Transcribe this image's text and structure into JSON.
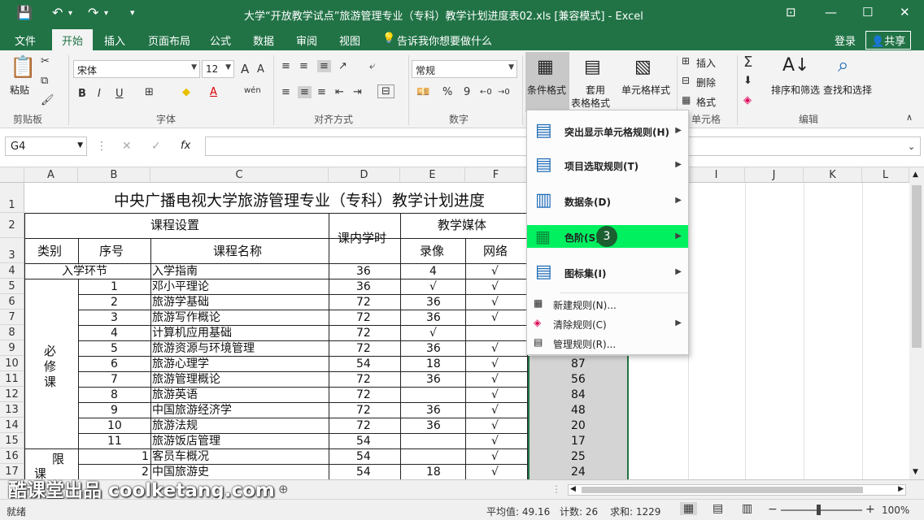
{
  "titlebar": {
    "title": "大学“开放教学试点”旅游管理专业（专科）教学计划进度表02.xls  [兼容模式] - Excel"
  },
  "tabs": [
    "文件",
    "开始",
    "插入",
    "页面布局",
    "公式",
    "数据",
    "审阅",
    "视图"
  ],
  "tellme": "告诉我你想要做什么",
  "login": "登录",
  "share": "共享",
  "ribbon": {
    "paste": "粘贴",
    "font_name": "宋体",
    "font_size": "12",
    "number_format": "常规",
    "percent": "%",
    "comma": "9",
    "cond_format": "条件格式",
    "table_format_1": "套用",
    "table_format_2": "表格格式",
    "cell_style": "单元格样式",
    "insert": "插入",
    "delete": "删除",
    "format": "格式",
    "sort_filter": "排序和筛选",
    "find_select": "查找和选择",
    "groups": {
      "clipboard": "剪贴板",
      "font": "字体",
      "align": "对齐方式",
      "number": "数字",
      "cells": "单元格",
      "edit": "编辑"
    }
  },
  "namebox": "G4",
  "fx": "fx",
  "columns": [
    "A",
    "B",
    "C",
    "D",
    "E",
    "F",
    "I",
    "J",
    "K",
    "L"
  ],
  "rows": [
    "1",
    "2",
    "3",
    "4",
    "5",
    "6",
    "7",
    "8",
    "9",
    "10",
    "11",
    "12",
    "13",
    "14",
    "15",
    "16",
    "17"
  ],
  "sheet": {
    "title": "中央广播电视大学旅游管理专业（专科）教学计划进度",
    "h_course_setting": "课程设置",
    "h_hours": "课内学时",
    "h_media": "教学媒体",
    "h_category": "类别",
    "h_no": "序号",
    "h_name": "课程名称",
    "h_video": "录像",
    "h_network": "网络",
    "r4": {
      "cat": "入学环节",
      "name": "入学指南",
      "hours": "36",
      "video": "4",
      "net": "√"
    },
    "bixiu": [
      "必",
      "修",
      "课"
    ],
    "xian": [
      "限"
    ],
    "ke": "课",
    "rows": [
      {
        "no": "1",
        "name": "邓小平理论",
        "hours": "36",
        "video": "√",
        "net": "√",
        "g": ""
      },
      {
        "no": "2",
        "name": "旅游学基础",
        "hours": "72",
        "video": "36",
        "net": "√",
        "g": ""
      },
      {
        "no": "3",
        "name": "旅游写作概论",
        "hours": "72",
        "video": "36",
        "net": "√",
        "g": ""
      },
      {
        "no": "4",
        "name": "计算机应用基础",
        "hours": "72",
        "video": "√",
        "net": "",
        "g": ""
      },
      {
        "no": "5",
        "name": "旅游资源与环境管理",
        "hours": "72",
        "video": "36",
        "net": "√",
        "g": ""
      },
      {
        "no": "6",
        "name": "旅游心理学",
        "hours": "54",
        "video": "18",
        "net": "√",
        "g": "87"
      },
      {
        "no": "7",
        "name": "旅游管理概论",
        "hours": "72",
        "video": "36",
        "net": "√",
        "g": "56"
      },
      {
        "no": "8",
        "name": "旅游英语",
        "hours": "72",
        "video": "",
        "net": "√",
        "g": "84"
      },
      {
        "no": "9",
        "name": "中国旅游经济学",
        "hours": "72",
        "video": "36",
        "net": "√",
        "g": "48"
      },
      {
        "no": "10",
        "name": "旅游法规",
        "hours": "72",
        "video": "36",
        "net": "√",
        "g": "20"
      },
      {
        "no": "11",
        "name": "旅游饭店管理",
        "hours": "54",
        "video": "",
        "net": "√",
        "g": "17"
      },
      {
        "no": "1",
        "name": "客员车概况",
        "hours": "54",
        "video": "",
        "net": "√",
        "g": "25"
      },
      {
        "no": "2",
        "name": "中国旅游史",
        "hours": "54",
        "video": "18",
        "net": "√",
        "g": "24"
      }
    ]
  },
  "cf_menu": {
    "items": [
      {
        "label": "突出显示单元格规则(H)"
      },
      {
        "label": "项目选取规则(T)"
      },
      {
        "label": "数据条(D)"
      },
      {
        "label": "色阶(S)"
      },
      {
        "label": "图标集(I)"
      }
    ],
    "small": [
      {
        "label": "新建规则(N)..."
      },
      {
        "label": "清除规则(C)"
      },
      {
        "label": "管理规则(R)..."
      }
    ],
    "step_badge": "3",
    "highlight_color": "#00f060"
  },
  "watermark": "酷课堂出品 coolketang.com",
  "status": {
    "mode": "就绪",
    "average": "平均值: 49.16",
    "count": "计数: 26",
    "sum": "求和: 1229",
    "zoom": "100%"
  },
  "colors": {
    "accent": "#217346"
  }
}
